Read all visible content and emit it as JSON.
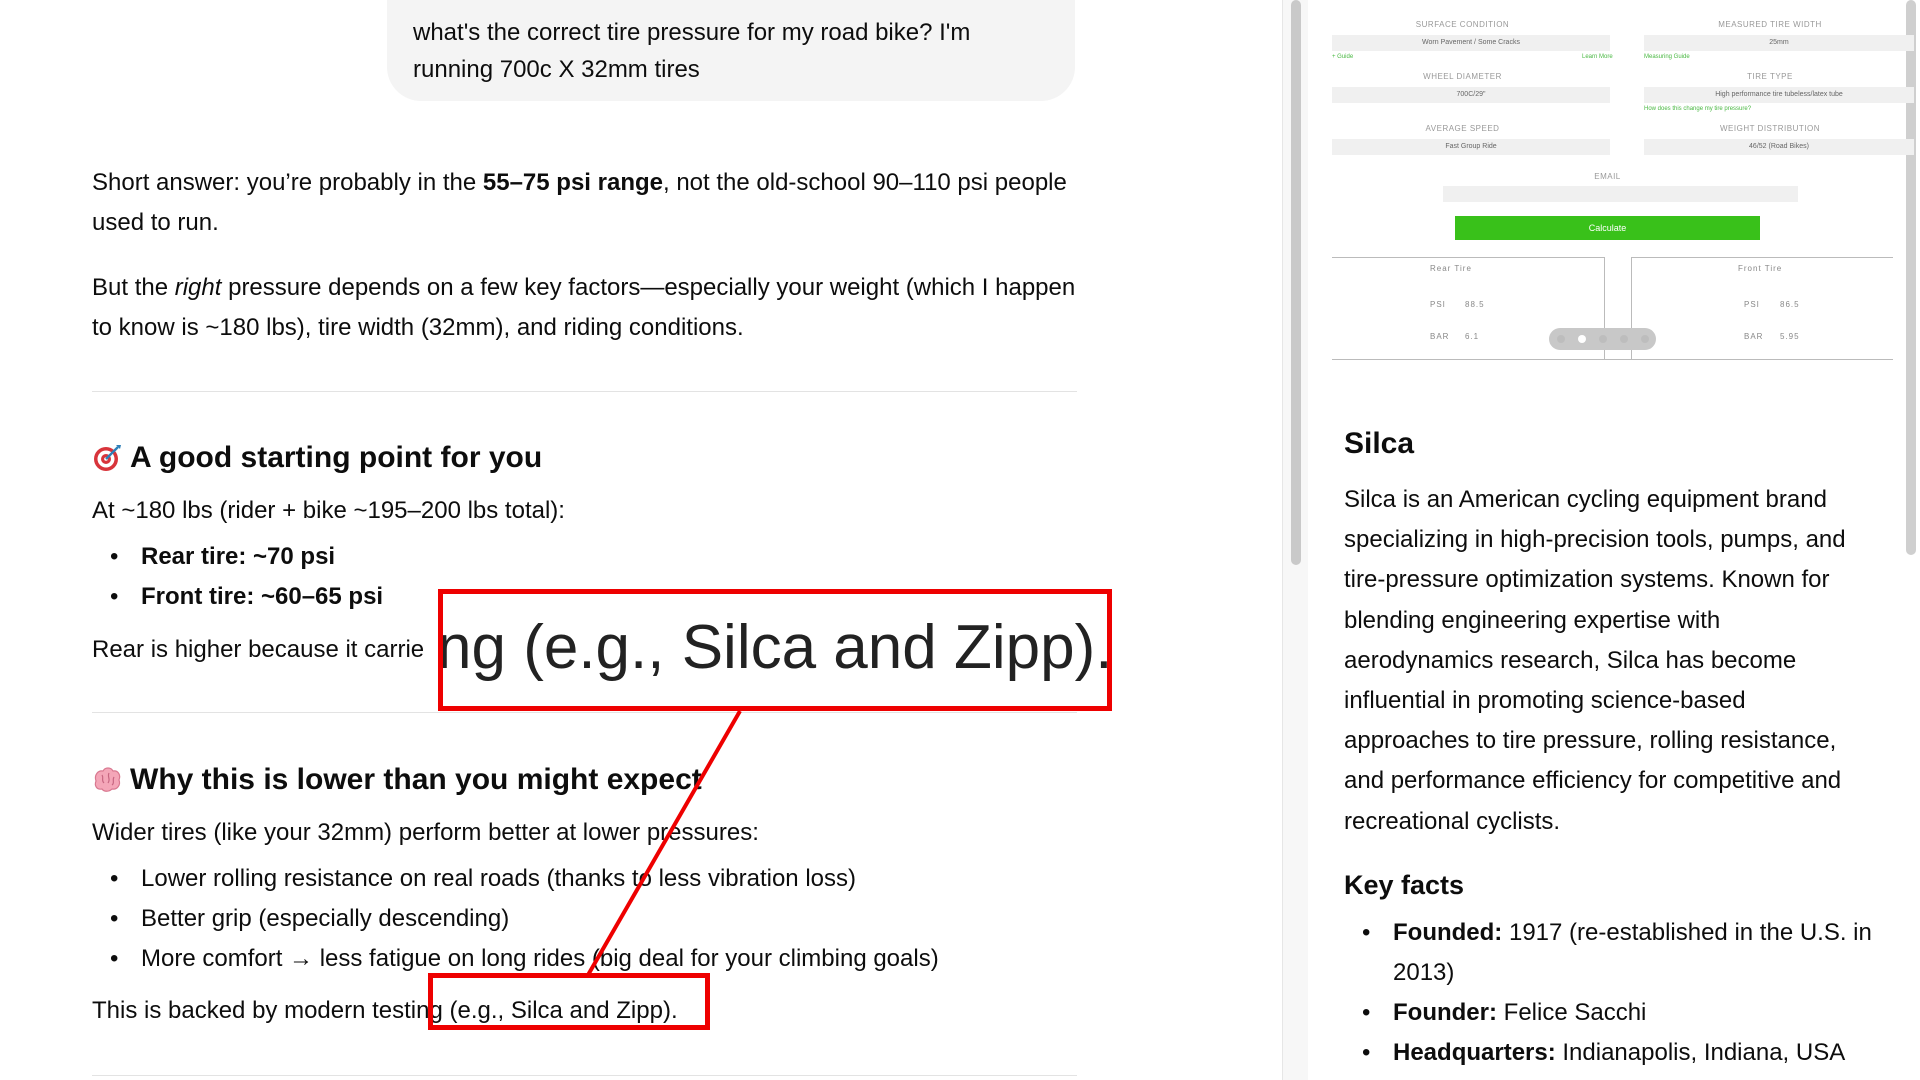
{
  "user_message": {
    "line1": "what's the correct tire pressure for my road bike? I'm",
    "line2": "running 700c X 32mm tires"
  },
  "answer": {
    "p1_a": "Short answer: you’re probably in the ",
    "p1_bold": "55–75 psi range",
    "p1_b": ", not the old-school 90–110 psi people used to run.",
    "p2_a": "But the ",
    "p2_italic": "right",
    "p2_b": " pressure depends on a few key factors—especially your weight (which I happen to know is ~180 lbs), tire width (32mm), and riding conditions.",
    "section1": {
      "title": "A good starting point for you",
      "icon": "target-icon",
      "intro": "At ~180 lbs (rider + bike ~195–200 lbs total):",
      "bullets": [
        {
          "label": "Rear tire:",
          "value": " ~70 psi"
        },
        {
          "label": "Front tire:",
          "value": " ~60–65 psi"
        }
      ],
      "note": "Rear is higher because it carrie"
    },
    "section2": {
      "title": "Why this is lower than you might expect",
      "icon": "brain-icon",
      "intro": "Wider tires (like your 32mm) perform better at lower pressures:",
      "bullets": [
        "Lower rolling resistance on real roads (thanks to less vibration loss)",
        "Better grip (especially descending)",
        "More comfort → less fatigue on long rides (big deal for your climbing goals)"
      ],
      "footer": "This is backed by modern testing (e.g., Silca and Zipp)."
    }
  },
  "annotation": {
    "zoom_text": "ng (e.g., Silca and Zipp).",
    "color": "#e00000"
  },
  "calculator": {
    "fields": [
      {
        "label": "Surface Condition",
        "value": "Worn Pavement / Some Cracks"
      },
      {
        "label": "Measured Tire Width",
        "value": "25mm"
      },
      {
        "label": "Wheel Diameter",
        "value": "700C/29\""
      },
      {
        "label": "Tire Type",
        "value": "High performance tire tubeless/latex tube"
      },
      {
        "label": "Average Speed",
        "value": "Fast Group Ride"
      },
      {
        "label": "Weight Distribution",
        "value": "46/52 (Road Bikes)"
      }
    ],
    "links": [
      "+ Guide",
      "Learn More",
      "Measuring Guide",
      "How does this change my tire pressure?"
    ],
    "email_label": "Email",
    "button": "Calculate",
    "rear": {
      "title": "Rear Tire",
      "psi_label": "PSI",
      "psi": "88.5",
      "bar_label": "BAR",
      "bar": "6.1"
    },
    "front": {
      "title": "Front Tire",
      "psi_label": "PSI",
      "psi": "86.5",
      "bar_label": "BAR",
      "bar": "5.95"
    }
  },
  "entity": {
    "name": "Silca",
    "description": "Silca is an American cycling equipment brand specializing in high-precision tools, pumps, and tire-pressure optimization systems. Known for blending engineering expertise with aerodynamics research, Silca has become influential in promoting science-based approaches to tire pressure, rolling resistance, and performance efficiency for competitive and recreational cyclists.",
    "key_facts_title": "Key facts",
    "facts": [
      {
        "label": "Founded:",
        "value": " 1917 (re-established in the U.S. in 2013)"
      },
      {
        "label": "Founder:",
        "value": " Felice Sacchi"
      },
      {
        "label": "Headquarters:",
        "value": " Indianapolis, Indiana, USA"
      }
    ]
  }
}
